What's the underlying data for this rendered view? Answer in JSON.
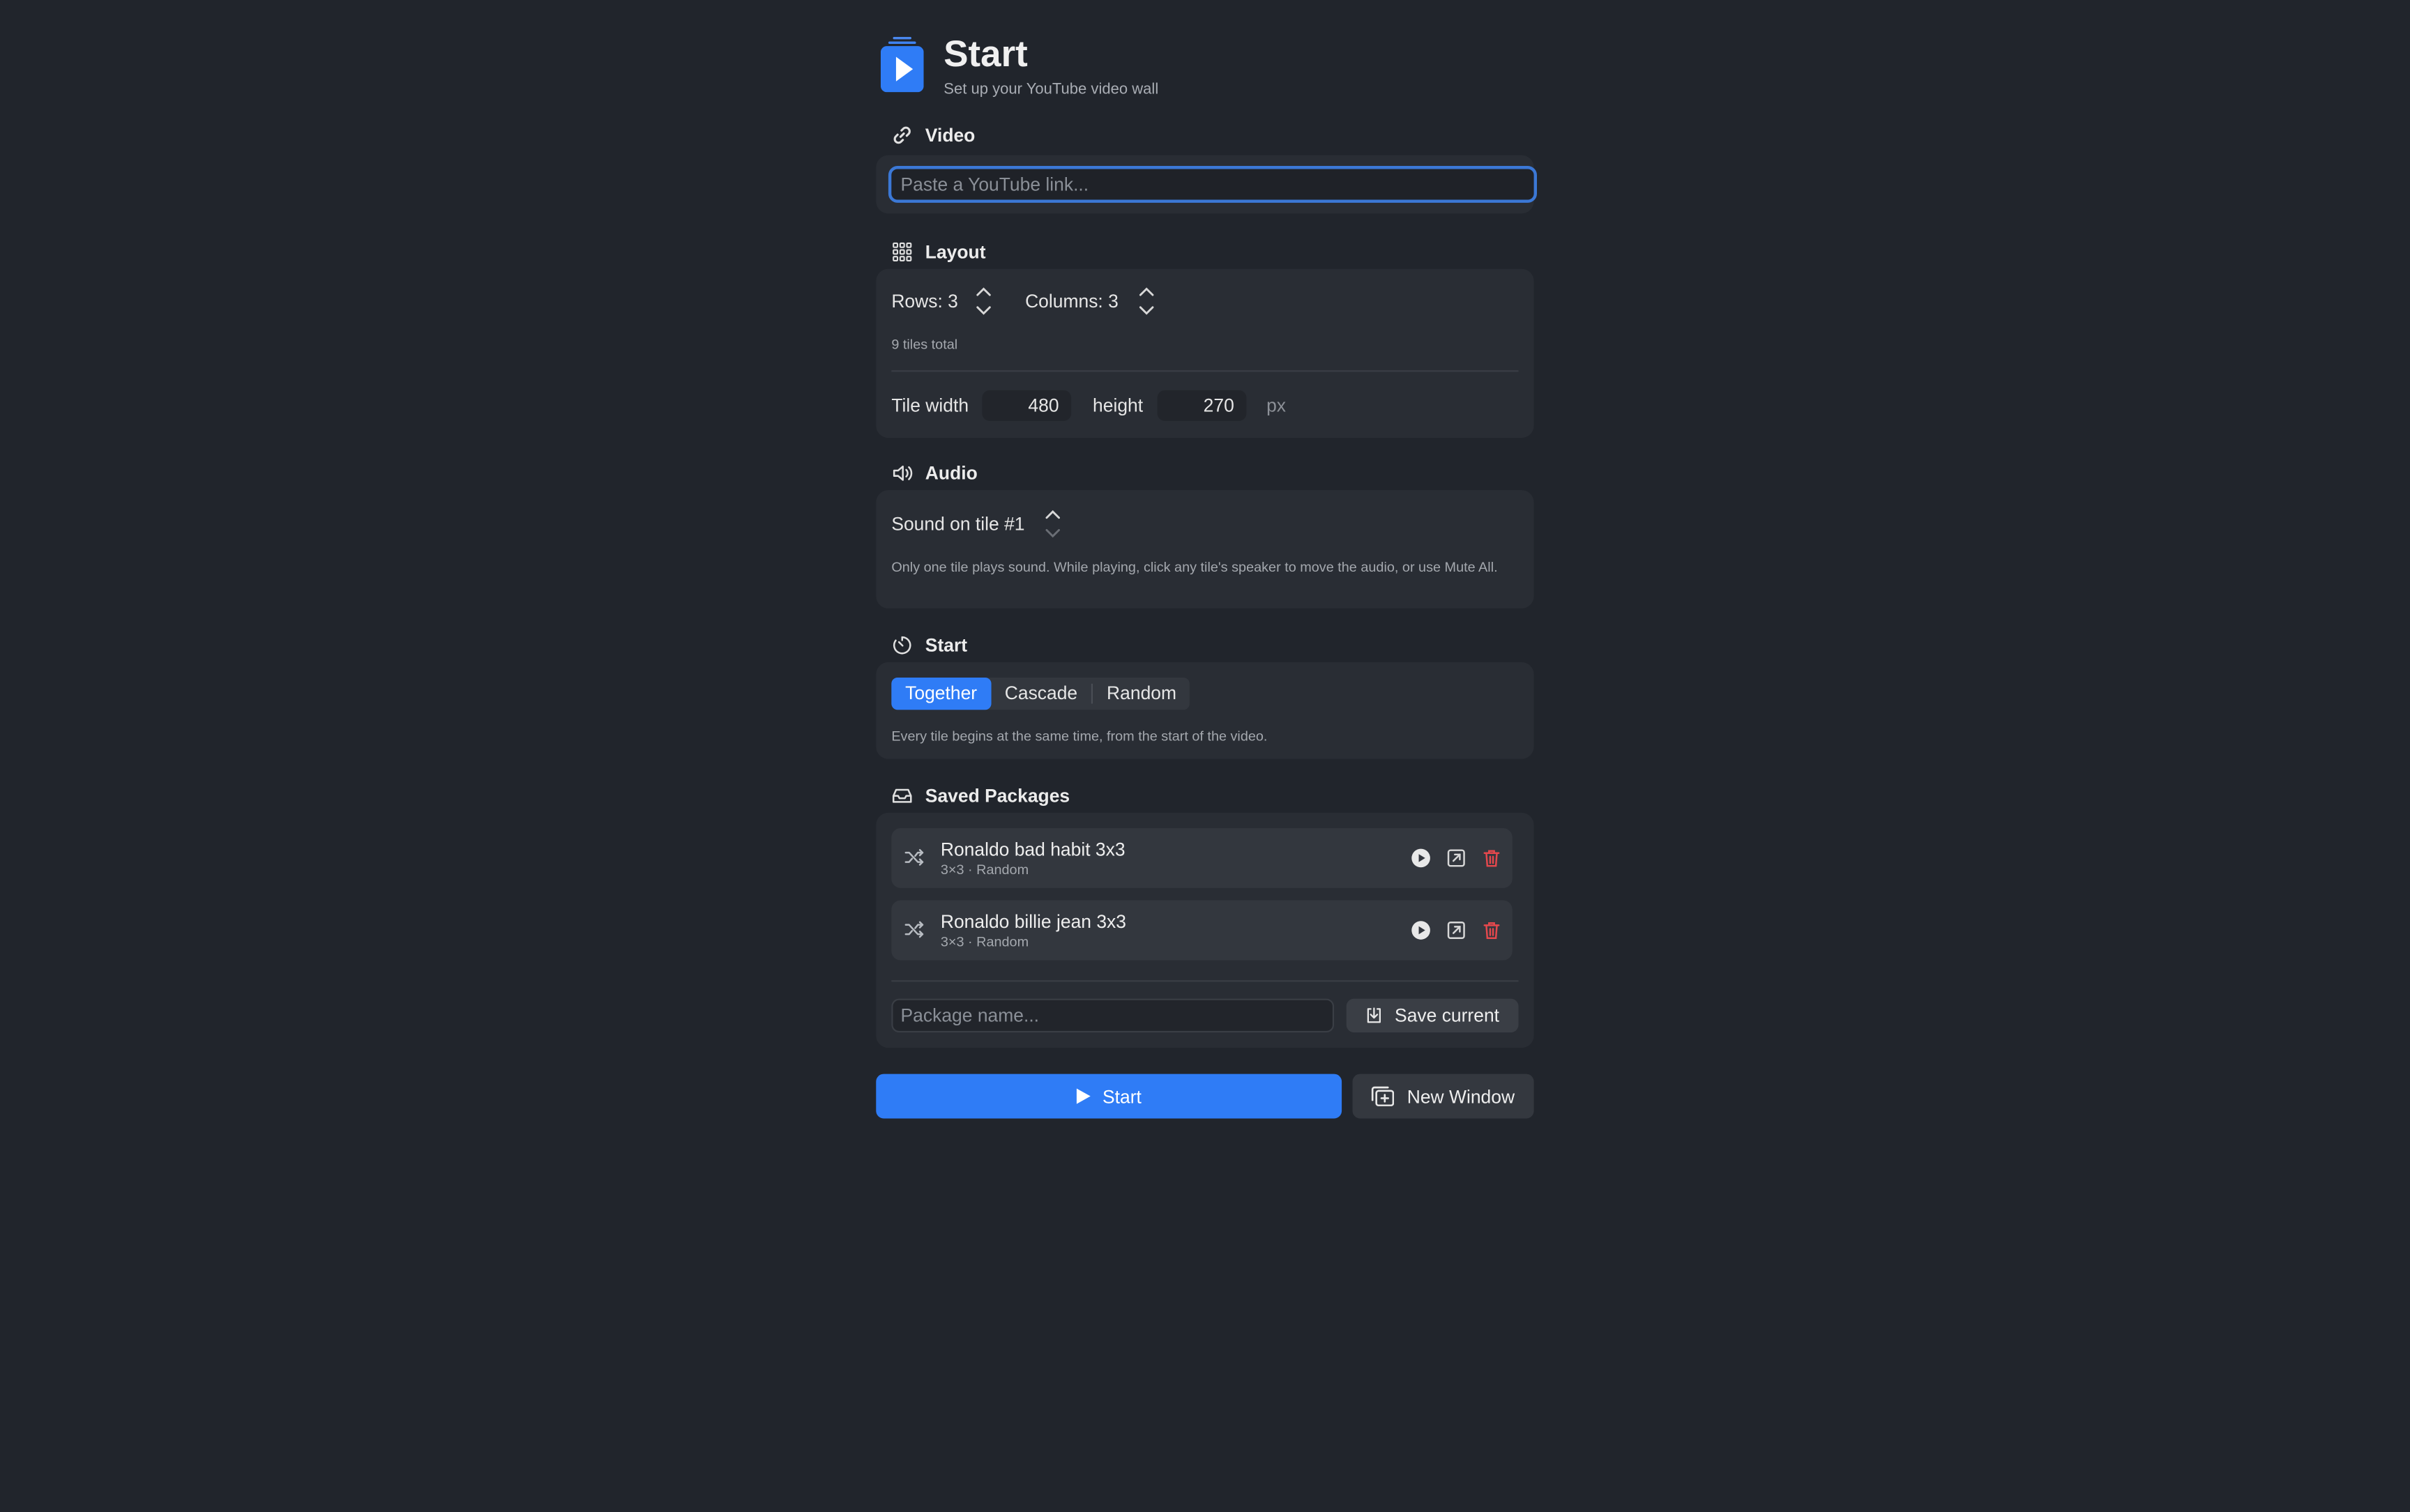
{
  "header": {
    "title": "Start",
    "subtitle": "Set up your YouTube video wall"
  },
  "video": {
    "heading": "Video",
    "url_value": "",
    "url_placeholder": "Paste a YouTube link..."
  },
  "layout": {
    "heading": "Layout",
    "rows_label": "Rows: 3",
    "rows": 3,
    "columns_label": "Columns: 3",
    "columns": 3,
    "tiles_total": "9 tiles total",
    "tile_width_label": "Tile width",
    "tile_width": "480",
    "height_label": "height",
    "tile_height": "270",
    "unit": "px"
  },
  "audio": {
    "heading": "Audio",
    "sound_label": "Sound on tile #1",
    "sound_tile": 1,
    "note": "Only one tile plays sound. While playing, click any tile's speaker to move the audio, or use Mute All."
  },
  "start": {
    "heading": "Start",
    "modes": [
      "Together",
      "Cascade",
      "Random"
    ],
    "selected_mode": "Together",
    "mode_description": "Every tile begins at the same time, from the start of the video."
  },
  "packages": {
    "heading": "Saved Packages",
    "items": [
      {
        "name": "Ronaldo bad habit 3x3",
        "meta": "3×3 · Random"
      },
      {
        "name": "Ronaldo billie jean 3x3",
        "meta": "3×3 · Random"
      }
    ],
    "name_value": "",
    "name_placeholder": "Package name...",
    "save_label": "Save current"
  },
  "footer": {
    "start_label": "Start",
    "new_window_label": "New Window"
  },
  "colors": {
    "background": "#21252c",
    "card": "#292d34",
    "accent": "#2f7cf6",
    "danger": "#e5484d",
    "focus_ring": "#3b78d6"
  },
  "icons": {
    "logo": "play-stack-icon",
    "video": "link-icon",
    "layout": "grid-icon",
    "audio": "speaker-icon",
    "start": "timer-icon",
    "packages": "inbox-icon",
    "package_type": "shuffle-icon",
    "package_actions": [
      "play-icon",
      "open-external-icon",
      "trash-icon"
    ],
    "save": "save-download-icon",
    "start_button": "play-icon",
    "new_window": "new-window-icon"
  }
}
